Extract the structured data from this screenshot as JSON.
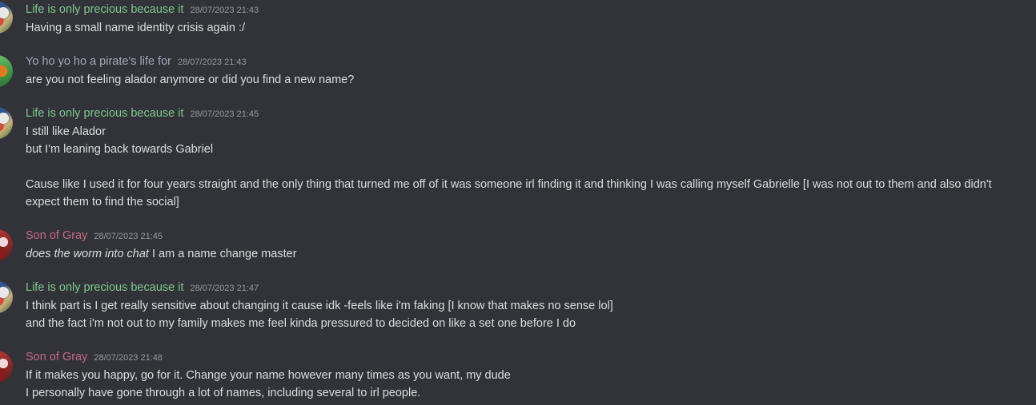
{
  "messages": [
    {
      "author": "Life is only precious because it",
      "timestamp": "28/07/2023 21:43",
      "lines": [
        "Having a small name identity crisis again :/"
      ]
    },
    {
      "author": "Yo ho yo ho a pirate's life for",
      "timestamp": "28/07/2023 21:43",
      "lines": [
        "are you not feeling alador anymore or did you find a new name?"
      ]
    },
    {
      "author": "Life is only precious because it",
      "timestamp": "28/07/2023 21:45",
      "lines": [
        "I still like Alador",
        "but I'm leaning back towards Gabriel",
        "Cause like I used it for four years straight and the only thing that turned me off of it was someone irl finding it and thinking I was calling myself Gabrielle [I was not out to them and also didn't expect them to find the social]"
      ]
    },
    {
      "author": "Son of Gray",
      "timestamp": "28/07/2023 21:45",
      "italic_part": "does the worm into chat",
      "rest": " I am a name change master"
    },
    {
      "author": "Life is only precious because it",
      "timestamp": "28/07/2023 21:47",
      "lines": [
        "I think part is I get really sensitive about changing it cause idk -feels like i'm faking [I know that makes no sense lol]",
        "and the fact i'm not out to my family makes me feel kinda pressured to decided on like a set one before I do"
      ]
    },
    {
      "author": "Son of Gray",
      "timestamp": "28/07/2023 21:48",
      "lines": [
        "If it makes you happy, go for it. Change your name however many times as you want, my dude",
        "I personally have gone through a lot of names, including several to irl people."
      ]
    }
  ]
}
